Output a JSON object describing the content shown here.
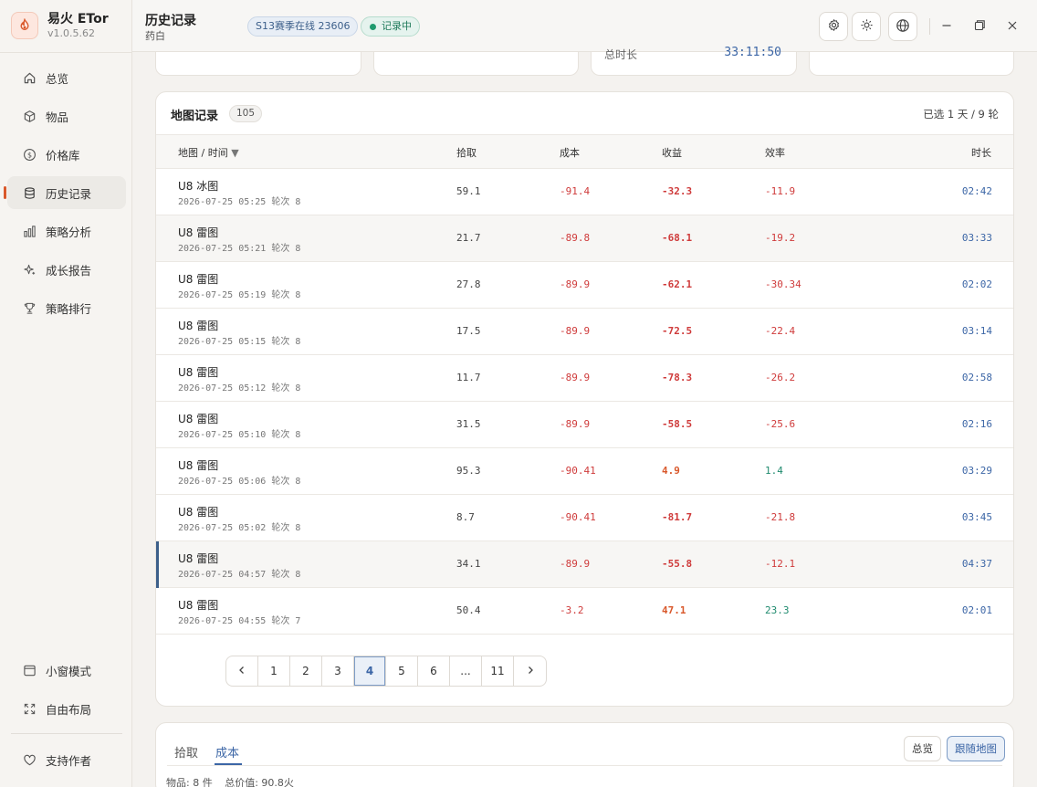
{
  "app": {
    "name": "易火 ETor",
    "version": "v1.0.5.62"
  },
  "header": {
    "title": "历史记录",
    "subtitle": "药白",
    "season_pill": "S13赛季在线 23606",
    "recording_pill": "记录中"
  },
  "sidebar": {
    "items": [
      {
        "label": "总览",
        "icon": "home-icon"
      },
      {
        "label": "物品",
        "icon": "cube-icon"
      },
      {
        "label": "价格库",
        "icon": "dollar-icon"
      },
      {
        "label": "历史记录",
        "icon": "database-icon",
        "active": true
      },
      {
        "label": "策略分析",
        "icon": "bar-chart-icon"
      },
      {
        "label": "成长报告",
        "icon": "sparkle-icon"
      },
      {
        "label": "策略排行",
        "icon": "trophy-icon"
      }
    ],
    "bottom": [
      {
        "label": "小窗模式",
        "icon": "window-icon"
      },
      {
        "label": "自由布局",
        "icon": "expand-icon"
      }
    ],
    "support": {
      "label": "支持作者",
      "icon": "heart-icon"
    }
  },
  "top_cards": [
    {
      "label": "",
      "value": ""
    },
    {
      "label": "",
      "value": ""
    },
    {
      "label": "总时长",
      "value": "33:11:50"
    },
    {
      "label": "",
      "value": ""
    }
  ],
  "map_records": {
    "title": "地图记录",
    "count": "105",
    "selection": "已选 1 天 / 9 轮",
    "columns": {
      "map": "地图 / 时间",
      "pick": "拾取",
      "cost": "成本",
      "income": "收益",
      "efficiency": "效率",
      "duration": "时长"
    },
    "sort_indicator": "▼",
    "rows": [
      {
        "map": "U8 冰图",
        "time": "2026-07-25 05:25 轮次 8",
        "pick": "59.1",
        "cost": "-91.4",
        "income": "-32.3",
        "efficiency": "-11.9",
        "duration": "02:42"
      },
      {
        "map": "U8 雷图",
        "time": "2026-07-25 05:21 轮次 8",
        "pick": "21.7",
        "cost": "-89.8",
        "income": "-68.1",
        "efficiency": "-19.2",
        "duration": "03:33"
      },
      {
        "map": "U8 雷图",
        "time": "2026-07-25 05:19 轮次 8",
        "pick": "27.8",
        "cost": "-89.9",
        "income": "-62.1",
        "efficiency": "-30.34",
        "duration": "02:02"
      },
      {
        "map": "U8 雷图",
        "time": "2026-07-25 05:15 轮次 8",
        "pick": "17.5",
        "cost": "-89.9",
        "income": "-72.5",
        "efficiency": "-22.4",
        "duration": "03:14"
      },
      {
        "map": "U8 雷图",
        "time": "2026-07-25 05:12 轮次 8",
        "pick": "11.7",
        "cost": "-89.9",
        "income": "-78.3",
        "efficiency": "-26.2",
        "duration": "02:58"
      },
      {
        "map": "U8 雷图",
        "time": "2026-07-25 05:10 轮次 8",
        "pick": "31.5",
        "cost": "-89.9",
        "income": "-58.5",
        "efficiency": "-25.6",
        "duration": "02:16"
      },
      {
        "map": "U8 雷图",
        "time": "2026-07-25 05:06 轮次 8",
        "pick": "95.3",
        "cost": "-90.41",
        "income": "4.9",
        "efficiency": "1.4",
        "duration": "03:29"
      },
      {
        "map": "U8 雷图",
        "time": "2026-07-25 05:02 轮次 8",
        "pick": "8.7",
        "cost": "-90.41",
        "income": "-81.7",
        "efficiency": "-21.8",
        "duration": "03:45"
      },
      {
        "map": "U8 雷图",
        "time": "2026-07-25 04:57 轮次 8",
        "pick": "34.1",
        "cost": "-89.9",
        "income": "-55.8",
        "efficiency": "-12.1",
        "duration": "04:37"
      },
      {
        "map": "U8 雷图",
        "time": "2026-07-25 04:55 轮次 7",
        "pick": "50.4",
        "cost": "-3.2",
        "income": "47.1",
        "efficiency": "23.3",
        "duration": "02:01"
      }
    ]
  },
  "pagination": {
    "prev": "‹",
    "next": "›",
    "pages": [
      "1",
      "2",
      "3",
      "4",
      "5",
      "6",
      "...",
      "11"
    ],
    "current": "4"
  },
  "bottom_panel": {
    "tabs": [
      "拾取",
      "成本"
    ],
    "active_tab": "成本",
    "buttons": {
      "overview": "总览",
      "follow_map": "跟随地图"
    },
    "footer_items": "物品: 8 件",
    "footer_value": "总价值: 90.8火"
  },
  "colors": {
    "accent": "#3c66a6",
    "negative": "#cf3b3b",
    "positive_income": "#d9582b",
    "positive_efficiency": "#1f8a6e",
    "brand": "#d9582b"
  }
}
